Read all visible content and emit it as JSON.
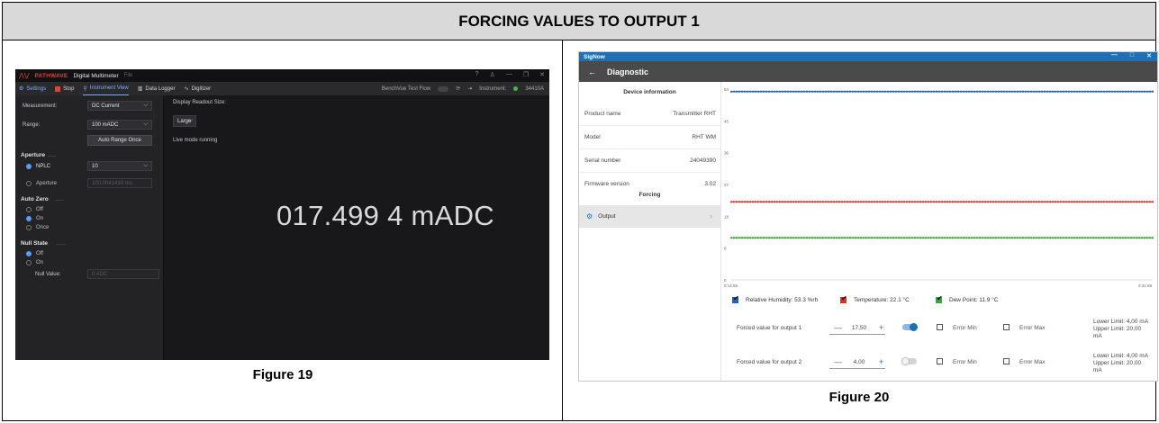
{
  "header": {
    "title": "FORCING VALUES TO OUTPUT 1"
  },
  "figure19": {
    "caption": "Figure 19",
    "titlebar": {
      "brand": "PATHWAVE",
      "app": "Digital Multimeter",
      "file": "File",
      "buttons": [
        "?",
        "♙",
        "—",
        "❐",
        "✕"
      ]
    },
    "toolbar": {
      "settings": "Settings",
      "stop": "Stop",
      "instrument_view": "Instrument View",
      "data_logger": "Data Logger",
      "digitizer": "Digitizer",
      "benchvue": "BenchVue Test Flow",
      "instrument_label": "Instrument:",
      "instrument_id": "34410A"
    },
    "settings": {
      "measurement_label": "Measurement:",
      "measurement_value": "DC Current",
      "range_label": "Range:",
      "range_value": "100 mADC",
      "auto_range_button": "Auto Range Once",
      "aperture_section": "Aperture",
      "nplc_label": "NPLC",
      "nplc_value": "10",
      "aperture_label": "Aperture",
      "aperture_value": "100.0041410 ms",
      "auto_zero_section": "Auto Zero",
      "auto_zero_options": [
        "Off",
        "On",
        "Once"
      ],
      "null_state_section": "Null State",
      "null_state_options": [
        "Off",
        "On"
      ],
      "null_value_label": "Null Value:",
      "null_value_placeholder": "0 ADC"
    },
    "display": {
      "readout_size_label": "Display Readout Size:",
      "readout_size_value": "Large",
      "status": "Live mode running",
      "reading": "017.499 4 mADC"
    }
  },
  "figure20": {
    "caption": "Figure 20",
    "titlebar": {
      "app": "SigNow",
      "buttons": [
        "—",
        "□",
        "✕"
      ]
    },
    "header": {
      "back": "←",
      "title": "Diagnostic"
    },
    "device_info": {
      "title": "Device information",
      "rows": [
        {
          "label": "Product name",
          "value": "Transmitter RHT"
        },
        {
          "label": "Model",
          "value": "RHT WM"
        },
        {
          "label": "Serial number",
          "value": "24049390"
        },
        {
          "label": "Firmware version",
          "value": "3.02"
        }
      ],
      "forcing_title": "Forcing",
      "output_item": "Output"
    },
    "legend": [
      {
        "label": "Relative Humidity: 53.3 %rh",
        "color": "#1f63b5"
      },
      {
        "label": "Temperature: 22.1 °C",
        "color": "#d9342b"
      },
      {
        "label": "Dew Point: 11.9 °C",
        "color": "#3aa53a"
      }
    ],
    "outputs": [
      {
        "label": "Forced value for output 1",
        "value": "17,50",
        "toggle_on": true,
        "error_min": "Error Min",
        "error_max": "Error Max",
        "lower_limit": "Lower Limit: 4,00 mA",
        "upper_limit": "Upper Limit: 20,00 mA"
      },
      {
        "label": "Forced value for output 2",
        "value": "4,00",
        "toggle_on": false,
        "error_min": "Error Min",
        "error_max": "Error Max",
        "lower_limit": "Lower Limit: 4,00 mA",
        "upper_limit": "Upper Limit: 20,00 mA"
      }
    ]
  },
  "chart_data": {
    "type": "line",
    "x_start": "0:14:55",
    "x_end": "0:31:55",
    "y_ticks": [
      "54",
      "45",
      "36",
      "27",
      "18",
      "9",
      "0"
    ],
    "ylim": [
      0,
      54
    ],
    "series": [
      {
        "name": "Relative Humidity: 53.3 %rh",
        "color": "#1f63b5",
        "value": 53.3
      },
      {
        "name": "Temperature: 22.1 °C",
        "color": "#d9342b",
        "value": 22.1
      },
      {
        "name": "Dew Point: 11.9 °C",
        "color": "#3aa53a",
        "value": 11.9
      }
    ]
  }
}
